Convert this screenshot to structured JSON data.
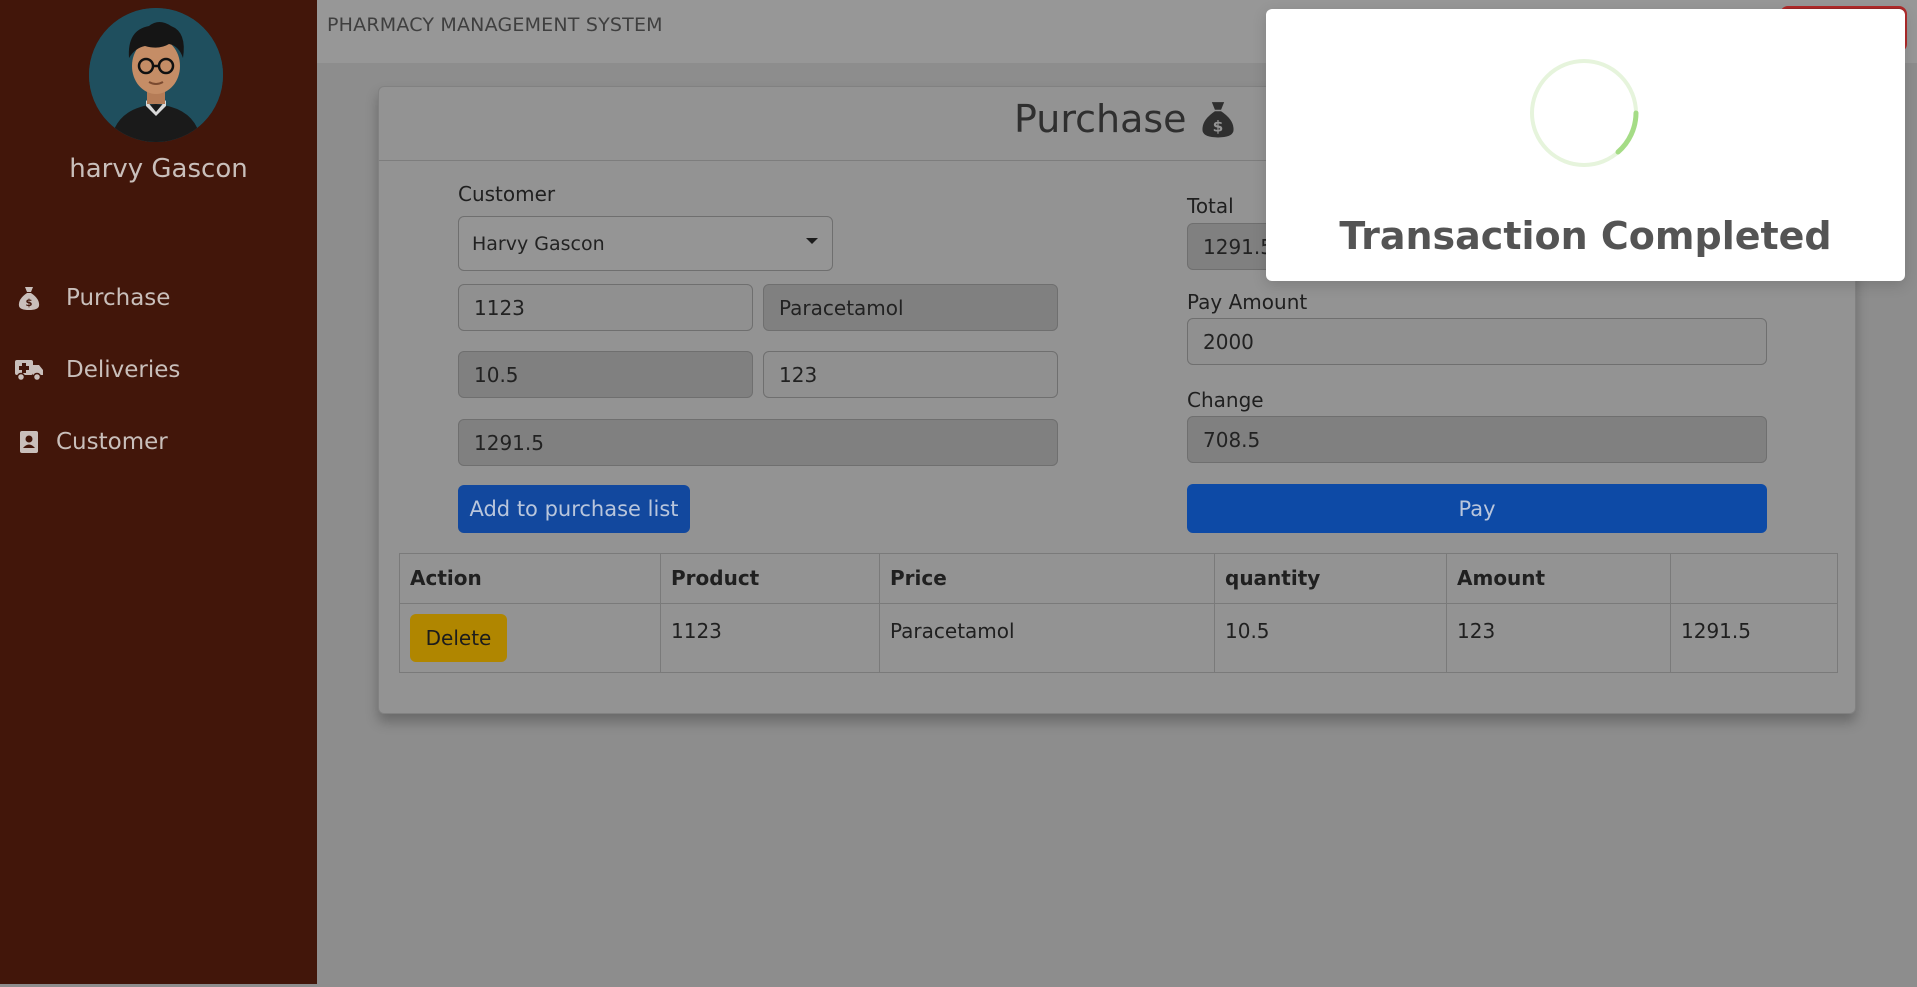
{
  "sidebar": {
    "user_name": "harvy Gascon",
    "items": [
      {
        "label": "Purchase",
        "icon": "money-bag-icon"
      },
      {
        "label": "Deliveries",
        "icon": "truck-medical-icon"
      },
      {
        "label": "Customer",
        "icon": "contact-book-icon"
      }
    ]
  },
  "header": {
    "app_title": "PHARMACY MANAGEMENT SYSTEM"
  },
  "purchase": {
    "title": "Purchase",
    "customer_label": "Customer",
    "customer_selected": "Harvy Gascon",
    "product_code": "1123",
    "product_name": "Paracetamol",
    "price": "10.5",
    "quantity": "123",
    "amount": "1291.5",
    "add_button": "Add to purchase list",
    "total_label": "Total",
    "total_value": "1291.5",
    "pay_amount_label": "Pay Amount",
    "pay_amount_value": "2000",
    "change_label": "Change",
    "change_value": "708.5",
    "pay_button": "Pay"
  },
  "table": {
    "headers": [
      "Action",
      "Product",
      "Price",
      "quantity",
      "Amount",
      ""
    ],
    "rows": [
      {
        "action": "Delete",
        "product": "1123",
        "price": "Paracetamol",
        "quantity": "10.5",
        "amount": "123",
        "extra": "1291.5"
      }
    ]
  },
  "modal": {
    "title": "Transaction Completed",
    "spinner_color": "#a5dc86"
  },
  "colors": {
    "sidebar": "#42160a",
    "primary_button": "#0d6efd",
    "warning_button": "#ffc107"
  }
}
